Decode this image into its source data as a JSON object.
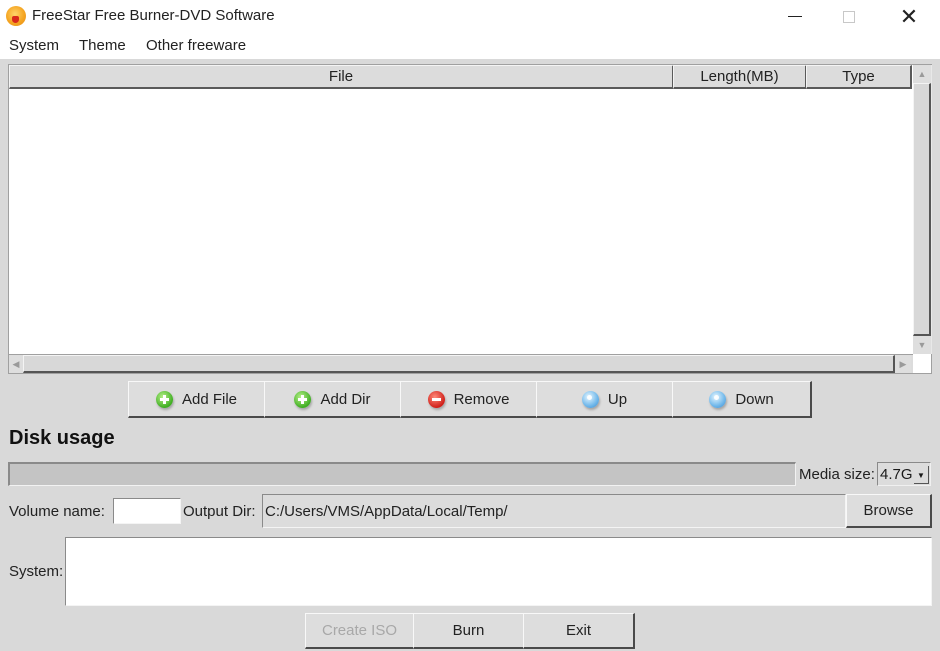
{
  "window": {
    "title": "FreeStar Free Burner-DVD Software",
    "controls": {
      "minimize": "—",
      "maximize": "",
      "close": "✕"
    }
  },
  "menu": {
    "items": [
      {
        "label": "System"
      },
      {
        "label": "Theme"
      },
      {
        "label": "Other freeware"
      }
    ]
  },
  "file_table": {
    "columns": [
      "File",
      "Length(MB)",
      "Type"
    ],
    "rows": [],
    "scroll_up": "▲",
    "scroll_down": "▼",
    "scroll_left": "◀",
    "scroll_right": "▶"
  },
  "list_buttons": [
    {
      "label": "Add File",
      "icon": "add-icon"
    },
    {
      "label": "Add Dir",
      "icon": "add-icon"
    },
    {
      "label": "Remove",
      "icon": "remove-icon"
    },
    {
      "label": "Up",
      "icon": "up-icon"
    },
    {
      "label": "Down",
      "icon": "down-icon"
    }
  ],
  "disk": {
    "heading": "Disk usage",
    "usage_fraction": 0,
    "media_size_label": "Media size:",
    "media_size_value": "4.7G",
    "dropdown_arrow": "▼"
  },
  "volume": {
    "label": "Volume name:",
    "value": ""
  },
  "output": {
    "label": "Output Dir:",
    "value": "C:/Users/VMS/AppData/Local/Temp/",
    "browse_label": "Browse"
  },
  "system_log": {
    "label": "System:",
    "value": ""
  },
  "actions": {
    "create_iso": "Create ISO",
    "burn": "Burn",
    "exit": "Exit"
  }
}
